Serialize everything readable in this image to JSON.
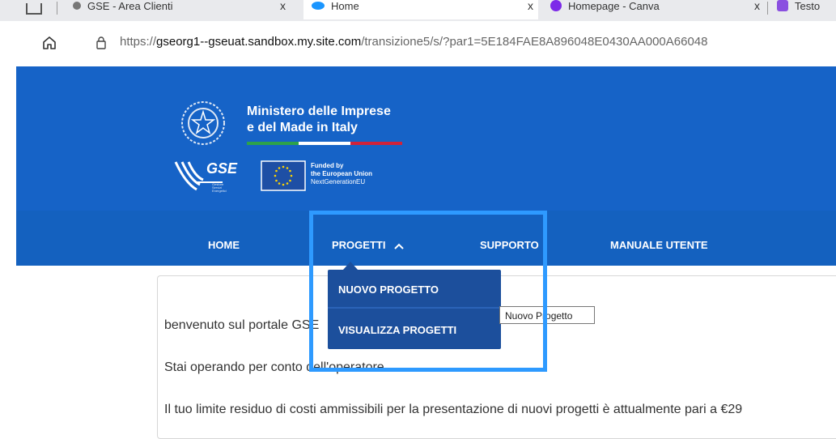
{
  "browser": {
    "tabs": [
      {
        "title": "GSE - Area Clienti",
        "active": false
      },
      {
        "title": "Home",
        "active": true
      },
      {
        "title": "Homepage - Canva",
        "active": false
      },
      {
        "title": "Testo",
        "active": false
      }
    ],
    "close_glyph": "x",
    "url_scheme": "https://",
    "url_host": "gseorg1--gseuat.sandbox.my.site.com",
    "url_path": "/transizione5/s/?par1=5E184FAE8A896048E0430AA000A66048"
  },
  "header": {
    "ministry_line1": "Ministero delle Imprese",
    "ministry_line2": "e del Made in Italy",
    "gse_logo": "GSE",
    "gse_sub": "Gestore Servizi Energetici",
    "eu_line1": "Funded by",
    "eu_line2": "the European Union",
    "eu_line3": "NextGenerationEU",
    "colors": {
      "primary": "#1663c7",
      "dropdown": "#1c4f9c",
      "highlight": "#2e9aff"
    }
  },
  "nav": {
    "home": "HOME",
    "progetti": "PROGETTI",
    "supporto": "SUPPORTO",
    "manuale": "MANUALE UTENTE"
  },
  "dropdown": {
    "items": [
      "NUOVO PROGETTO",
      "VISUALIZZA PROGETTI"
    ]
  },
  "tooltip": "Nuovo Progetto",
  "content": {
    "welcome": "benvenuto sul portale GSE",
    "operator": "Stai operando per conto dell'operatore",
    "limit": "Il tuo limite residuo di costi ammissibili per la presentazione di nuovi progetti è attualmente pari a €29"
  }
}
